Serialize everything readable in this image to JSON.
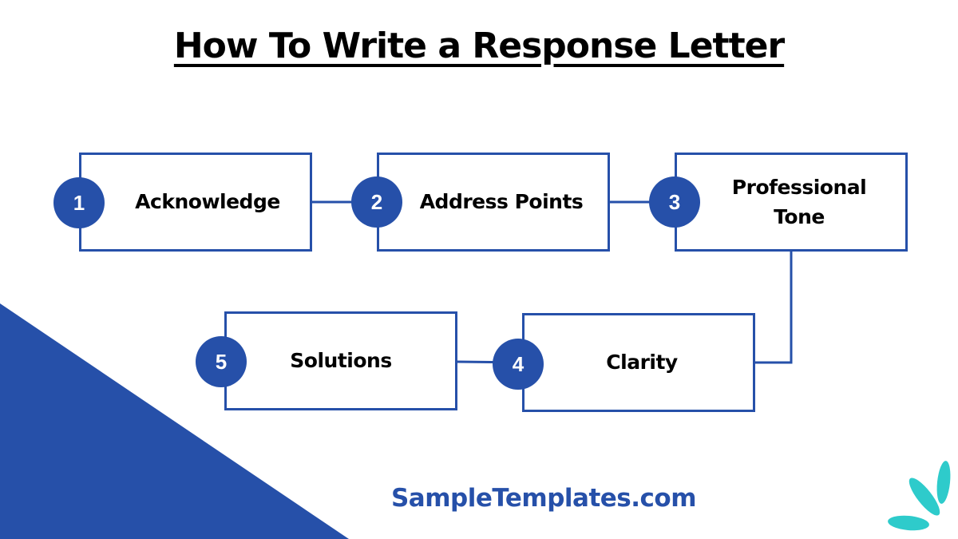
{
  "title": "How To Write a Response Letter",
  "colors": {
    "primary": "#2650A9",
    "accent": "#2ECBCB",
    "text": "#000000",
    "background": "#FFFFFF"
  },
  "steps": [
    {
      "number": "1",
      "label": "Acknowledge"
    },
    {
      "number": "2",
      "label": "Address Points"
    },
    {
      "number": "3",
      "label": "Professional Tone"
    },
    {
      "number": "4",
      "label": "Clarity"
    },
    {
      "number": "5",
      "label": "Solutions"
    }
  ],
  "flow": [
    "1 → 2",
    "2 → 3",
    "3 → 4",
    "4 → 5"
  ],
  "footer": {
    "brand": "SampleTemplates.com",
    "logo_icon": "leaf-sparkle-icon"
  }
}
